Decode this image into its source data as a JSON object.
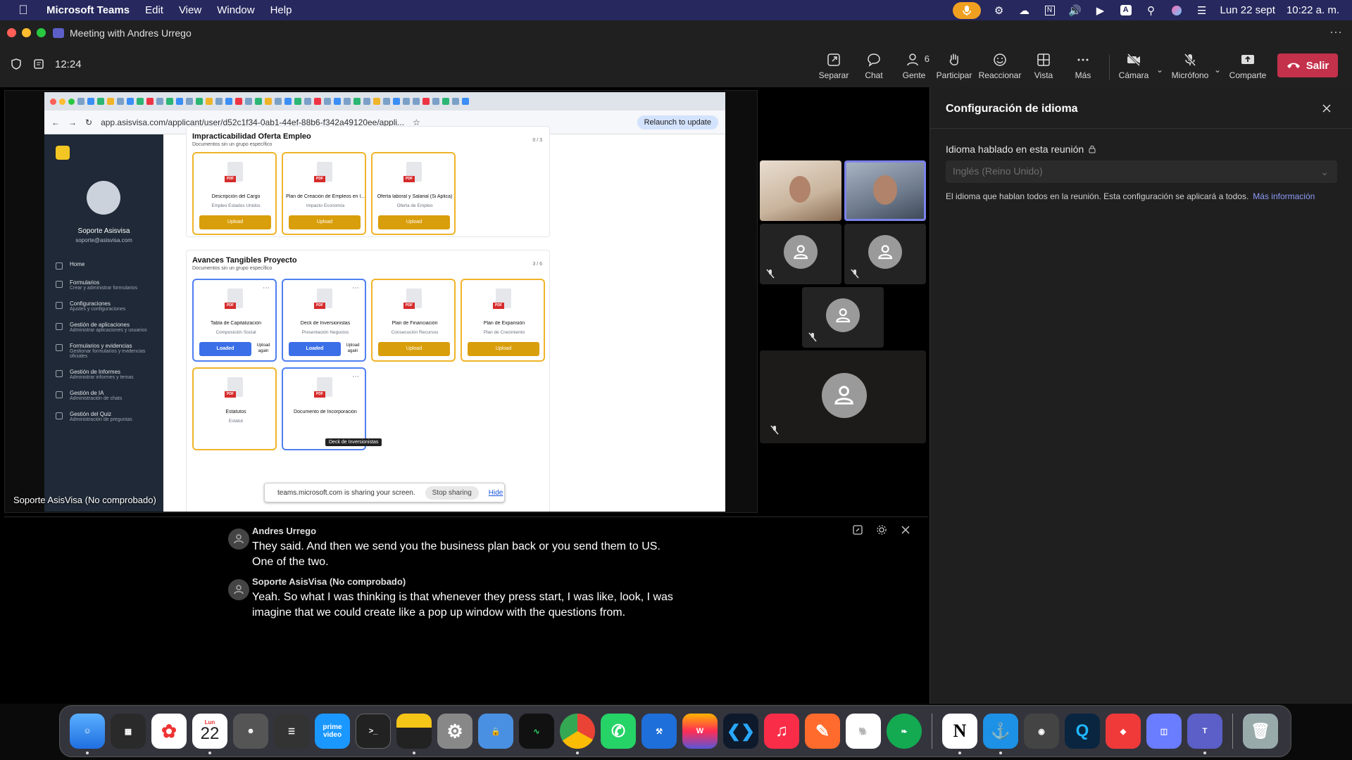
{
  "menubar": {
    "app_name": "Microsoft Teams",
    "menus": [
      "Edit",
      "View",
      "Window",
      "Help"
    ],
    "date": "Lun 22 sept",
    "time": "10:22 a. m."
  },
  "window": {
    "title": "Meeting with Andres Urrego"
  },
  "toolbar": {
    "timer": "12:24",
    "people_count": "6",
    "buttons": {
      "separar": "Separar",
      "chat": "Chat",
      "gente": "Gente",
      "participar": "Participar",
      "reaccionar": "Reaccionar",
      "vista": "Vista",
      "mas": "Más",
      "camara": "Cámara",
      "microfono": "Micrófono",
      "comparte": "Comparte",
      "salir": "Salir"
    }
  },
  "shared_screen": {
    "presenter_label": "Soporte AsisVisa (No comprobado)",
    "browser": {
      "url": "app.asisvisa.com/applicant/user/d52c1f34-0ab1-44ef-88b6-f342a49120ee/appli...",
      "relaunch": "Relaunch to update"
    },
    "sidebar": {
      "user_name": "Soporte Asisvisa",
      "user_email": "soporte@asisvisa.com",
      "items": [
        {
          "label": "Home",
          "sub": ""
        },
        {
          "label": "Formularios",
          "sub": "Crear y administrar formularios"
        },
        {
          "label": "Configuraciones",
          "sub": "Ajustes y configuraciones"
        },
        {
          "label": "Gestión de aplicaciones",
          "sub": "Administrar aplicaciones y usuarios"
        },
        {
          "label": "Formularios y evidencias",
          "sub": "Gestionar formularios y evidencias oficiales"
        },
        {
          "label": "Gestión de Informes",
          "sub": "Administrar informes y temas"
        },
        {
          "label": "Gestión de IA",
          "sub": "Administración de chats"
        },
        {
          "label": "Gestión del Quiz",
          "sub": "Administración de preguntas"
        }
      ]
    },
    "section1": {
      "title": "Impracticabilidad Oferta Empleo",
      "subtitle": "Documentos sin un grupo específico",
      "count": "0 / 3",
      "docs": [
        {
          "name": "Descripción del Cargo",
          "category": "Empleo Estados Unidos",
          "action": "Upload"
        },
        {
          "name": "Plan de Creación de Empleos en l...",
          "category": "Impacto Economía",
          "action": "Upload"
        },
        {
          "name": "Oferta laboral y Salarial (Si Aplica)",
          "category": "Oferta de Empleo",
          "action": "Upload"
        }
      ]
    },
    "section2": {
      "title": "Avances Tangibles Proyecto",
      "subtitle": "Documentos sin un grupo específico",
      "count": "3 / 6",
      "docs": [
        {
          "name": "Tabla de Capitalización",
          "category": "Composición Social",
          "action": "Loaded",
          "secondary": "Upload again"
        },
        {
          "name": "Deck de Inversionistas",
          "category": "Presentación Negocios",
          "action": "Loaded",
          "secondary": "Upload again"
        },
        {
          "name": "Plan de Financiación",
          "category": "Consecución Recursos",
          "action": "Upload"
        },
        {
          "name": "Plan de Expansión",
          "category": "Plan de Crecimiento",
          "action": "Upload"
        },
        {
          "name": "Estatutos",
          "category": "Estatut",
          "action": ""
        },
        {
          "name": "Documento de Incorporación",
          "category": "",
          "action": ""
        }
      ],
      "tooltip": "Deck de Inversionistas"
    },
    "pdf_tag": "PDF",
    "share_banner": {
      "text": "teams.microsoft.com is sharing your screen.",
      "stop": "Stop sharing",
      "hide": "Hide"
    }
  },
  "captions": [
    {
      "speaker": "Andres Urrego",
      "text": "They said. And then we send you the business plan back or you send them to US. One of the two."
    },
    {
      "speaker": "Soporte AsisVisa (No comprobado)",
      "text": "Yeah. So what I was thinking is that whenever they press start, I was like, look, I was imagine that we could create like a pop up window with the questions from."
    }
  ],
  "panel": {
    "title": "Configuración de idioma",
    "label": "Idioma hablado en esta reunión",
    "selected_language": "Inglés (Reino Unido)",
    "description": "El idioma que hablan todos en la reunión. Esta configuración se aplicará a todos.",
    "more_info": "Más información"
  },
  "dock": {
    "calendar_day": "22",
    "calendar_month": "Lun",
    "prime_label": "prime video"
  },
  "colors": {
    "menubar_bg": "#26285e",
    "leave_red": "#c4314b",
    "accent": "#7b83eb",
    "upload_gold": "#d99e0b",
    "loaded_blue": "#3b6fe8"
  }
}
